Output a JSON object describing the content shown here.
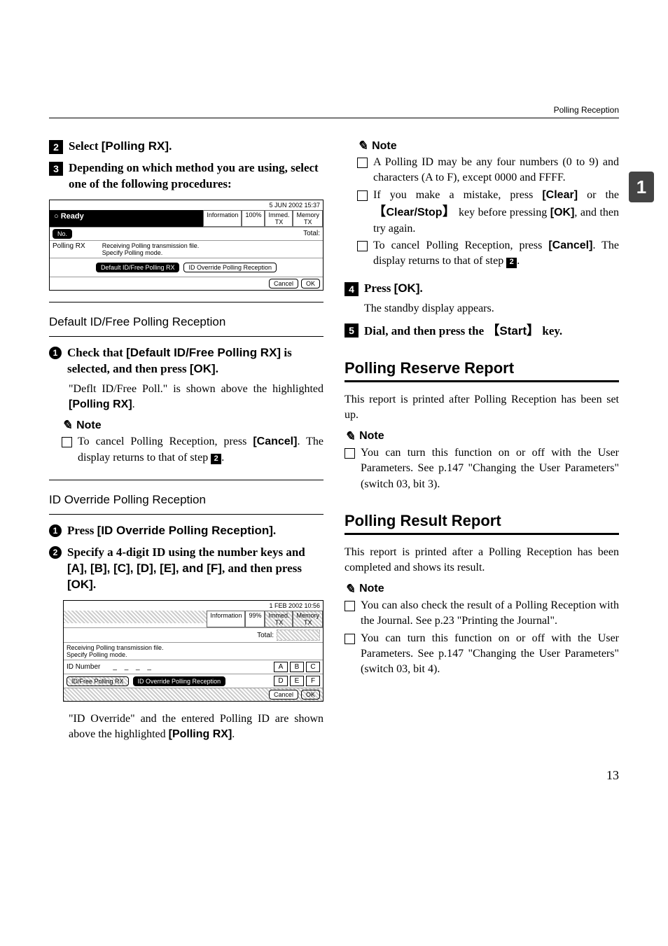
{
  "header": {
    "title": "Polling Reception"
  },
  "sidetab": {
    "label": "1"
  },
  "left": {
    "step2": {
      "num": "2",
      "prefix": "Select ",
      "bold": "[Polling RX]",
      "suffix": "."
    },
    "step3": {
      "num": "3",
      "text": "Depending on which method you are using, select one of the following procedures:"
    },
    "shot1": {
      "date": "5 JUN   2002 15:37",
      "ready": "Ready",
      "info": "Information",
      "pct": "100%",
      "immed": "Immed.\nTX",
      "mem": "Memory\nTX",
      "num_label": "No.",
      "total": "Total:",
      "polling": "Polling RX",
      "desc": "Receiving Polling transmission file.\nSpecify Polling mode.",
      "btn1": "Default ID/Free Polling RX",
      "btn2": "ID Override Polling Reception",
      "cancel": "Cancel",
      "ok": "OK"
    },
    "sub_default": "Default ID/Free Polling Reception",
    "default_bullet": {
      "num": "1",
      "prefix": "Check that ",
      "bold1": "[Default ID/Free Polling RX]",
      "middle": " is selected, and then press ",
      "bold2": "[OK]",
      "suffix": "."
    },
    "default_body": {
      "pre": "\"Deflt ID/Free Poll.\" is shown above the highlighted ",
      "bold": "[Polling RX]",
      "post": "."
    },
    "note_label": "Note",
    "default_note": {
      "pre": "To cancel Polling Reception, press ",
      "bold": "[Cancel]",
      "mid": ". The display returns to that of step ",
      "stepref": "2",
      "post": "."
    },
    "sub_id": "ID Override Polling Reception",
    "id_b1": {
      "num": "1",
      "prefix": "Press ",
      "bold": "[ID Override Polling Reception]",
      "suffix": "."
    },
    "id_b2": {
      "num": "2",
      "prefix": "Specify a 4-digit ID using the number keys and ",
      "keys": "[A], [B], [C], [D], [E], and [F]",
      "mid": ", and then press ",
      "ok": "[OK]",
      "suffix": "."
    },
    "shot2": {
      "date": "1 FEB   2002 10:56",
      "info": "Information",
      "pct": "99%",
      "immed": "Immed.\nTX",
      "mem": "Memory\nTX",
      "total": "Total:",
      "desc": "Receiving Polling transmission file.\nSpecify Polling mode.",
      "num_label": "ID Number",
      "letters": [
        "A",
        "B",
        "C",
        "D",
        "E",
        "F"
      ],
      "btn1": "ID/Free Polling RX",
      "btn2": "ID Override Polling Reception",
      "cancel": "Cancel",
      "ok": "OK"
    },
    "id_body": {
      "text": "\"ID Override\" and the entered Polling ID are shown above the highlighted ",
      "bold": "[Polling RX]",
      "post": "."
    }
  },
  "right": {
    "note_label": "Note",
    "n1": "A Polling ID may be any four numbers (0 to 9) and characters (A to F), except 0000 and FFFF.",
    "n2": {
      "pre": "If you make a mistake, press ",
      "clear": "[Clear]",
      "mid1": " or the ",
      "key": "Clear/Stop",
      "mid2": " key before pressing ",
      "ok": "[OK]",
      "post": ", and then try again."
    },
    "n3": {
      "pre": "To cancel Polling Reception, press ",
      "cancel": "[Cancel]",
      "mid": ". The display returns to that of step ",
      "stepref": "2",
      "post": "."
    },
    "step4": {
      "num": "4",
      "prefix": "Press ",
      "bold": "[OK]",
      "suffix": "."
    },
    "step4_body": "The standby display appears.",
    "step5": {
      "num": "5",
      "prefix": "Dial, and then press the ",
      "key": "Start",
      "suffix": " key."
    },
    "sec_reserve": "Polling Reserve Report",
    "reserve_body": "This report is printed after Polling Reception has been set up.",
    "reserve_note": "You can turn this function on or off with the User Parameters. See p.147 \"Changing the User Parameters\" (switch 03, bit 3).",
    "sec_result": "Polling Result Report",
    "result_body": "This report is printed after a Polling Reception has been completed and shows its result.",
    "result_n1": "You can also check the result of a Polling Reception with the Journal. See p.23 \"Printing the Journal\".",
    "result_n2": "You can turn this function on or off with the User Parameters. See p.147 \"Changing the User Parameters\" (switch 03, bit 4)."
  },
  "pagenum": "13"
}
